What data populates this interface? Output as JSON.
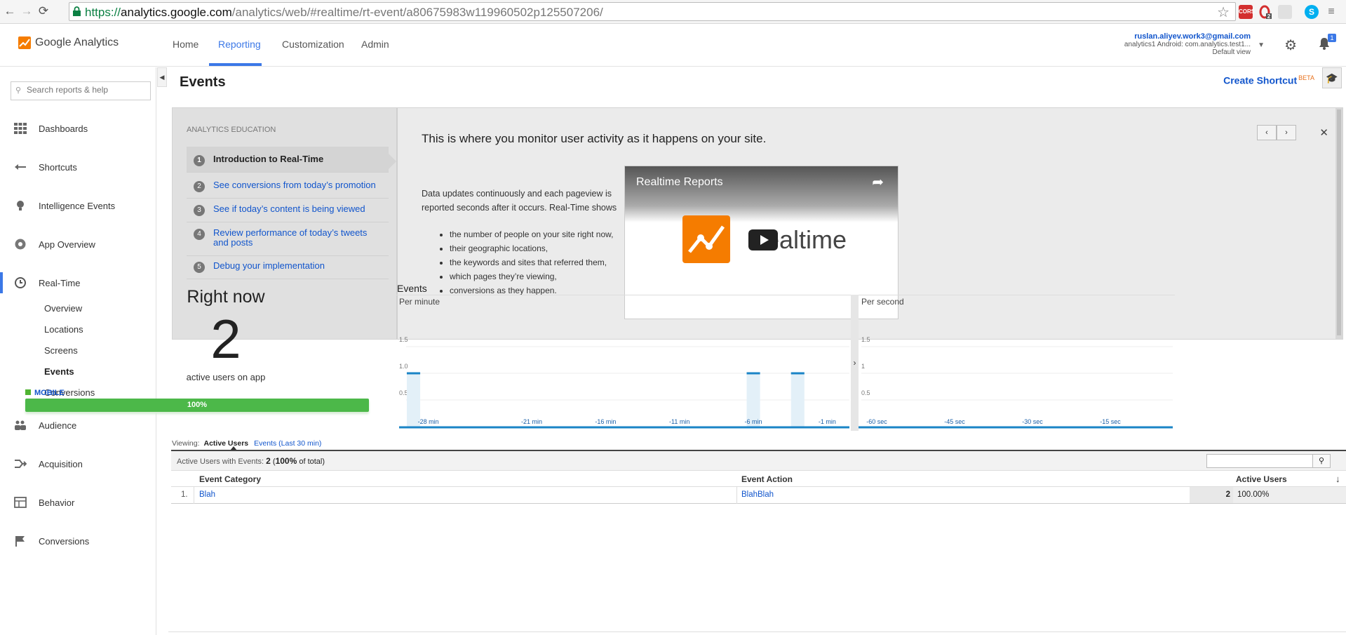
{
  "browser": {
    "url": {
      "scheme": "https://",
      "host": "analytics.google.com",
      "path": "/analytics/web/#realtime/rt-event/a80675983w119960502p125507206/"
    },
    "extensions": [
      "cors-extension-icon",
      "opera-extension-icon",
      "gray-extension-icon",
      "skype-icon"
    ],
    "extension_labels": {
      "cors": "CORS",
      "opera_badge": "2"
    }
  },
  "header": {
    "logo_text": "Google Analytics",
    "tabs": [
      {
        "label": "Home"
      },
      {
        "label": "Reporting",
        "active": true
      },
      {
        "label": "Customization"
      },
      {
        "label": "Admin"
      }
    ],
    "account": {
      "email": "ruslan.aliyev.work3@gmail.com",
      "property": "analytics1 Android: com.analytics.test1...",
      "view": "Default view"
    },
    "notification_count": "1"
  },
  "sidebar": {
    "search_placeholder": "Search reports & help",
    "items": [
      {
        "label": "Dashboards",
        "icon": "grid-icon"
      },
      {
        "label": "Shortcuts",
        "icon": "shortcut-arrow-icon"
      },
      {
        "label": "Intelligence Events",
        "icon": "lightbulb-icon"
      },
      {
        "label": "App Overview",
        "icon": "circle-icon"
      },
      {
        "label": "Real-Time",
        "icon": "clock-icon",
        "active": true
      },
      {
        "label": "Audience",
        "icon": "people-icon"
      },
      {
        "label": "Acquisition",
        "icon": "acquisition-arrows-icon"
      },
      {
        "label": "Behavior",
        "icon": "behavior-icon"
      },
      {
        "label": "Conversions",
        "icon": "flag-icon"
      }
    ],
    "realtime_subitems": [
      {
        "label": "Overview"
      },
      {
        "label": "Locations"
      },
      {
        "label": "Screens"
      },
      {
        "label": "Events",
        "active": true
      },
      {
        "label": "Conversions"
      }
    ]
  },
  "page": {
    "title": "Events",
    "shortcut_label": "Create Shortcut",
    "shortcut_badge": "BETA"
  },
  "education": {
    "heading": "ANALYTICS EDUCATION",
    "steps": [
      {
        "num": "1",
        "label": "Introduction to Real-Time",
        "current": true
      },
      {
        "num": "2",
        "label": "See conversions from today’s promotion"
      },
      {
        "num": "3",
        "label": "See if today’s content is being viewed"
      },
      {
        "num": "4",
        "label": "Review performance of today’s tweets and posts"
      },
      {
        "num": "5",
        "label": "Debug your implementation"
      }
    ],
    "headline": "This is where you monitor user activity as it happens on your site.",
    "body": "Data updates continuously and each pageview is reported seconds after it occurs. Real-Time shows",
    "bullets": [
      "the number of people on your site right now,",
      "their geographic locations,",
      "the keywords and sites that referred them,",
      "which pages they’re viewing,",
      "conversions as they happen."
    ],
    "video": {
      "title": "Realtime Reports",
      "word": "Realtime"
    }
  },
  "rightnow": {
    "title": "Right now",
    "value": "2",
    "subtitle": "active users on app",
    "segment_label": "MOBILE",
    "segment_percent": "100%",
    "segment_fraction": 1.0,
    "segment_color": "#4cb849"
  },
  "chart_data": [
    {
      "type": "bar",
      "title": "Events",
      "subtitle": "Per minute",
      "y_ticks": [
        "1.5",
        "1.0",
        "0.5"
      ],
      "ylim": [
        0,
        2
      ],
      "x_tick_labels": [
        "-28 min",
        "-21 min",
        "-16 min",
        "-11 min",
        "-6 min",
        "-1 min"
      ],
      "x": [
        -29,
        -28,
        -27,
        -26,
        -25,
        -24,
        -23,
        -22,
        -21,
        -20,
        -19,
        -18,
        -17,
        -16,
        -15,
        -14,
        -13,
        -12,
        -11,
        -10,
        -9,
        -8,
        -7,
        -6,
        -5,
        -4,
        -3,
        -2,
        -1,
        0
      ],
      "values": [
        1,
        0,
        0,
        0,
        0,
        0,
        0,
        0,
        0,
        0,
        0,
        0,
        0,
        0,
        0,
        0,
        0,
        0,
        0,
        0,
        0,
        0,
        0,
        1,
        0,
        0,
        1,
        0,
        0,
        0
      ],
      "color": "#1a84c6"
    },
    {
      "type": "bar",
      "subtitle": "Per second",
      "y_ticks": [
        "1.5",
        "1",
        "0.5"
      ],
      "ylim": [
        0,
        2
      ],
      "x_tick_labels": [
        "-60 sec",
        "-45 sec",
        "-30 sec",
        "-15 sec"
      ],
      "values": [],
      "color": "#1a84c6"
    }
  ],
  "report": {
    "viewing_label": "Viewing:",
    "view_active": "Active Users",
    "view_other": "Events (Last 30 min)",
    "summary_label": "Active Users with Events:",
    "summary_value": "2",
    "summary_percent": "100%",
    "summary_suffix": "of total)",
    "columns": [
      "Event Category",
      "Event Action",
      "Active Users"
    ],
    "rows": [
      {
        "index": "1.",
        "category": "Blah",
        "action": "BlahBlah",
        "users": "2",
        "percent": "100.00%"
      }
    ]
  }
}
